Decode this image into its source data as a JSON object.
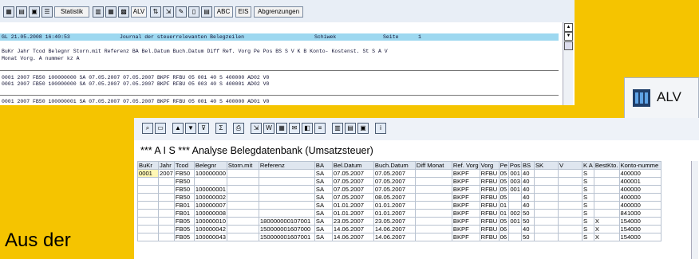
{
  "report_window": {
    "toolbar": {
      "statistik": "Statistik",
      "alv": "ALV",
      "abc": "ABC",
      "eis": "EIS",
      "abgrenzungen": "Abgrenzungen"
    },
    "header_line": {
      "id_date": "GL 21.05.2008  16:40:53",
      "title": "Journal der steuerrelevanten Belegzeilen",
      "user": "Schiwek",
      "page_label": "Seite",
      "page_no": "1"
    },
    "columns_row1": "BuKr Jahr Tcod  Belegnr    Storn.mit Referenz           BA Bel.Datum  Buch.Datum     Diff  Ref.  Vorg Pe Pos BS S V K B  Konto-     Kostenst.  St S A V",
    "columns_row2": "                                                                              Monat Vorg.                  A   nummer                kz A",
    "rows": [
      "0001 2007 FB50  100000000                     SA 07.05.2007 07.05.2007            BKPF  RFBU 05 001 40      S   400000     AD02       V0",
      "0001 2007 FB50  100000000                     SA 07.05.2007 07.05.2007            BKPF  RFBU 05 003 40      S   400001     AD02       V0",
      "0001 2007 FB50  100000001                     SA 07.05.2007 07.05.2007            BKPF  RFBU 05 001 40      S   400000     AD01       V0"
    ]
  },
  "alv_zoom": {
    "label": "ALV"
  },
  "alv_window": {
    "title": "*** A I S *** Analyse  Belegdatenbank  (Umsatzsteuer)",
    "columns": [
      "BuKr",
      "Jahr",
      "Tcod",
      "Belegnr",
      "Storn.mit",
      "Referenz",
      "BA",
      "Bel.Datum",
      "Buch.Datum",
      "Diff Monat",
      "Ref. Vorg",
      "Vorg",
      "Pe",
      "Pos",
      "BS",
      "SK",
      "V",
      "K A",
      "BestKto.",
      "Konto-numme"
    ],
    "rows": [
      [
        "0001",
        "2007",
        "FB50",
        "100000000",
        "",
        "",
        "SA",
        "07.05.2007",
        "07.05.2007",
        "",
        "BKPF",
        "RFBU",
        "05",
        "001",
        "40",
        "",
        "",
        "S",
        "",
        "400000"
      ],
      [
        "",
        "",
        "FB50",
        "",
        "",
        "",
        "SA",
        "07.05.2007",
        "07.05.2007",
        "",
        "BKPF",
        "RFBU",
        "05",
        "003",
        "40",
        "",
        "",
        "S",
        "",
        "400001"
      ],
      [
        "",
        "",
        "FB50",
        "100000001",
        "",
        "",
        "SA",
        "07.05.2007",
        "07.05.2007",
        "",
        "BKPF",
        "RFBU",
        "05",
        "001",
        "40",
        "",
        "",
        "S",
        "",
        "400000"
      ],
      [
        "",
        "",
        "FB50",
        "100000002",
        "",
        "",
        "SA",
        "07.05.2007",
        "08.05.2007",
        "",
        "BKPF",
        "RFBU",
        "05",
        "",
        "40",
        "",
        "",
        "S",
        "",
        "400000"
      ],
      [
        "",
        "",
        "FB01",
        "100000007",
        "",
        "",
        "SA",
        "01.01.2007",
        "01.01.2007",
        "",
        "BKPF",
        "RFBU",
        "01",
        "",
        "40",
        "",
        "",
        "S",
        "",
        "400000"
      ],
      [
        "",
        "",
        "FB01",
        "100000008",
        "",
        "",
        "SA",
        "01.01.2007",
        "01.01.2007",
        "",
        "BKPF",
        "RFBU",
        "01",
        "002",
        "50",
        "",
        "",
        "S",
        "",
        "841000"
      ],
      [
        "",
        "",
        "FB05",
        "100000010",
        "",
        "180000000107001",
        "SA",
        "23.05.2007",
        "23.05.2007",
        "",
        "BKPF",
        "RFBU",
        "05",
        "001",
        "50",
        "",
        "",
        "S",
        "X",
        "154000"
      ],
      [
        "",
        "",
        "FB05",
        "100000042",
        "",
        "150000001607000",
        "SA",
        "14.06.2007",
        "14.06.2007",
        "",
        "BKPF",
        "RFBU",
        "06",
        "",
        "40",
        "",
        "",
        "S",
        "X",
        "154000"
      ],
      [
        "",
        "",
        "FB05",
        "100000043",
        "",
        "150000001607001",
        "SA",
        "14.06.2007",
        "14.06.2007",
        "",
        "BKPF",
        "RFBU",
        "06",
        "",
        "50",
        "",
        "",
        "S",
        "X",
        "154000"
      ]
    ]
  },
  "caption": "Aus der"
}
